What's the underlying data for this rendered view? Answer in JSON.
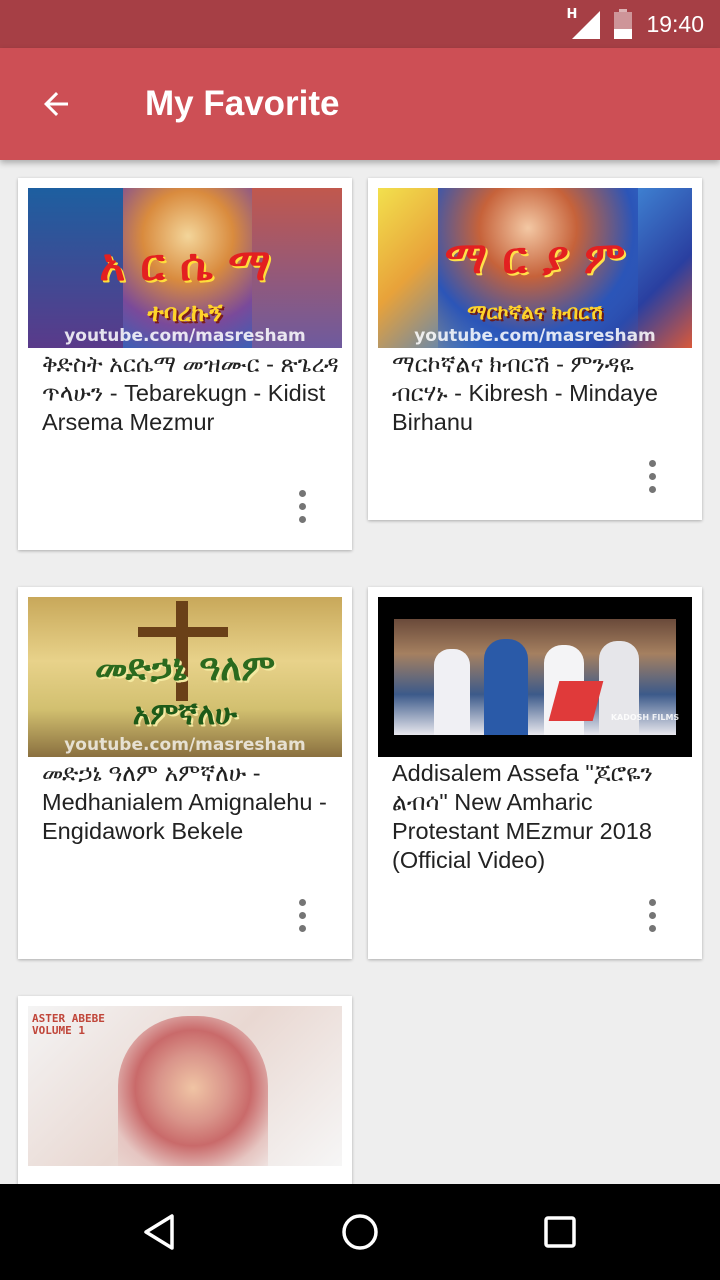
{
  "status": {
    "network": "H",
    "time": "19:40"
  },
  "appbar": {
    "title": "My Favorite",
    "back_icon": "arrow-back-icon"
  },
  "videos": [
    {
      "title": "ቅድስት አርሴማ መዝሙር - ጽጌረዳ ጥላሁን - Tebarekugn - Kidist Arsema Mezmur",
      "thumb_text": "አ ር ሴ ማ",
      "thumb_subtext": "ተባረኩኝ",
      "watermark": "youtube.com/masresham"
    },
    {
      "title": "ማርኮኛልና ክብርሽ - ምንዳዬ ብርሃኑ - Kibresh - Mindaye Birhanu",
      "thumb_text": "ማ ር ያ ም",
      "thumb_subtext": "ማርኮኛልና ክብርሽ",
      "watermark": "youtube.com/masresham"
    },
    {
      "title": "መድኃኔ ዓለም አምኛለሁ - Medhanialem Amignalehu - Engidawork Bekele",
      "thumb_text": "መድኃኔ ዓለም",
      "thumb_subtext": "አምኛለሁ",
      "watermark": "youtube.com/masresham"
    },
    {
      "title": "Addisalem Assefa \"ጆሮዬን ልብሳ\" New Amharic Protestant MEzmur 2018 (Official Video)",
      "thumb_text": "",
      "thumb_subtext": "",
      "watermark": "KADOSH FILMS"
    },
    {
      "title": "",
      "thumb_text": "ASTER ABEBE",
      "thumb_subtext": "VOLUME 1",
      "watermark": ""
    }
  ],
  "colors": {
    "statusbar": "#a63f45",
    "appbar": "#cd4f55",
    "background": "#eeeeee"
  },
  "navbar": {
    "icons": [
      "back-triangle-icon",
      "home-circle-icon",
      "recents-square-icon"
    ]
  }
}
